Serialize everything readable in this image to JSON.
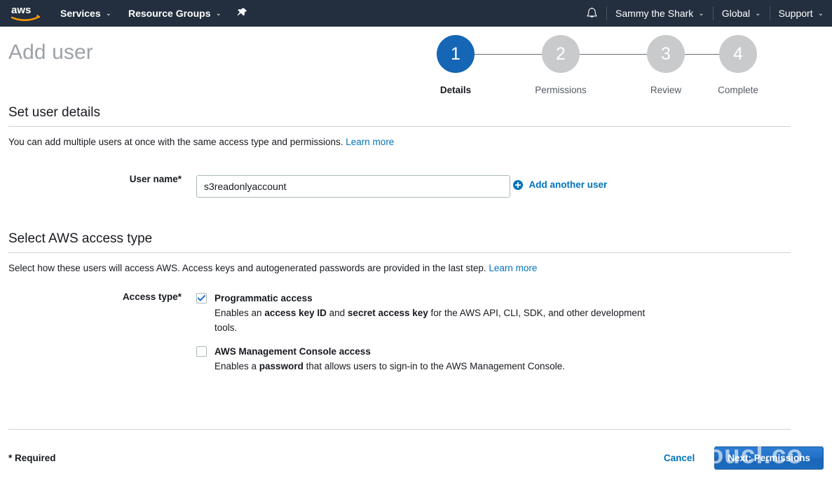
{
  "navbar": {
    "logo_alt": "aws",
    "items": [
      {
        "label": "Services",
        "caret": "⌄"
      },
      {
        "label": "Resource Groups",
        "caret": "⌄"
      }
    ],
    "pin_icon": "pushpin-icon",
    "bell_icon": "notification-bell-icon",
    "account": {
      "label": "Sammy the Shark",
      "caret": "⌄"
    },
    "region": {
      "label": "Global",
      "caret": "⌄"
    },
    "support": {
      "label": "Support",
      "caret": "⌄"
    }
  },
  "page": {
    "title": "Add user"
  },
  "wizard": {
    "steps": [
      {
        "number": "1",
        "label": "Details",
        "active": true
      },
      {
        "number": "2",
        "label": "Permissions",
        "active": false
      },
      {
        "number": "3",
        "label": "Review",
        "active": false
      },
      {
        "number": "4",
        "label": "Complete",
        "active": false
      }
    ],
    "active_color": "#1566b5",
    "inactive_color": "#c8cacb"
  },
  "user_details": {
    "heading": "Set user details",
    "description": "You can add multiple users at once with the same access type and permissions.",
    "learn_more": "Learn more",
    "username_label": "User name*",
    "username_value": "s3readonlyaccount",
    "username_placeholder": "",
    "add_another_label": "Add another user",
    "add_another_icon": "plus-circle-icon"
  },
  "access_type": {
    "heading": "Select AWS access type",
    "description": "Select how these users will access AWS. Access keys and autogenerated passwords are provided in the last step.",
    "learn_more": "Learn more",
    "label": "Access type*",
    "options": [
      {
        "title": "Programmatic access",
        "checked": true,
        "desc_prefix": "Enables an ",
        "desc_bold1": "access key ID",
        "desc_mid": " and ",
        "desc_bold2": "secret access key",
        "desc_suffix": " for the AWS API, CLI, SDK, and other development tools."
      },
      {
        "title": "AWS Management Console access",
        "checked": false,
        "desc_prefix": "Enables a ",
        "desc_bold1": "password",
        "desc_mid": "",
        "desc_bold2": "",
        "desc_suffix": " that allows users to sign-in to the AWS Management Console."
      }
    ]
  },
  "footer": {
    "required_note": "* Required",
    "cancel_label": "Cancel",
    "next_label": "Next: Permissions"
  },
  "watermark": {
    "text": "youcl.co"
  },
  "colors": {
    "nav_bg": "#232f3e",
    "link_blue": "#0073bb",
    "primary_button": "#1f6fc4",
    "title_gray": "#9da2a8"
  }
}
